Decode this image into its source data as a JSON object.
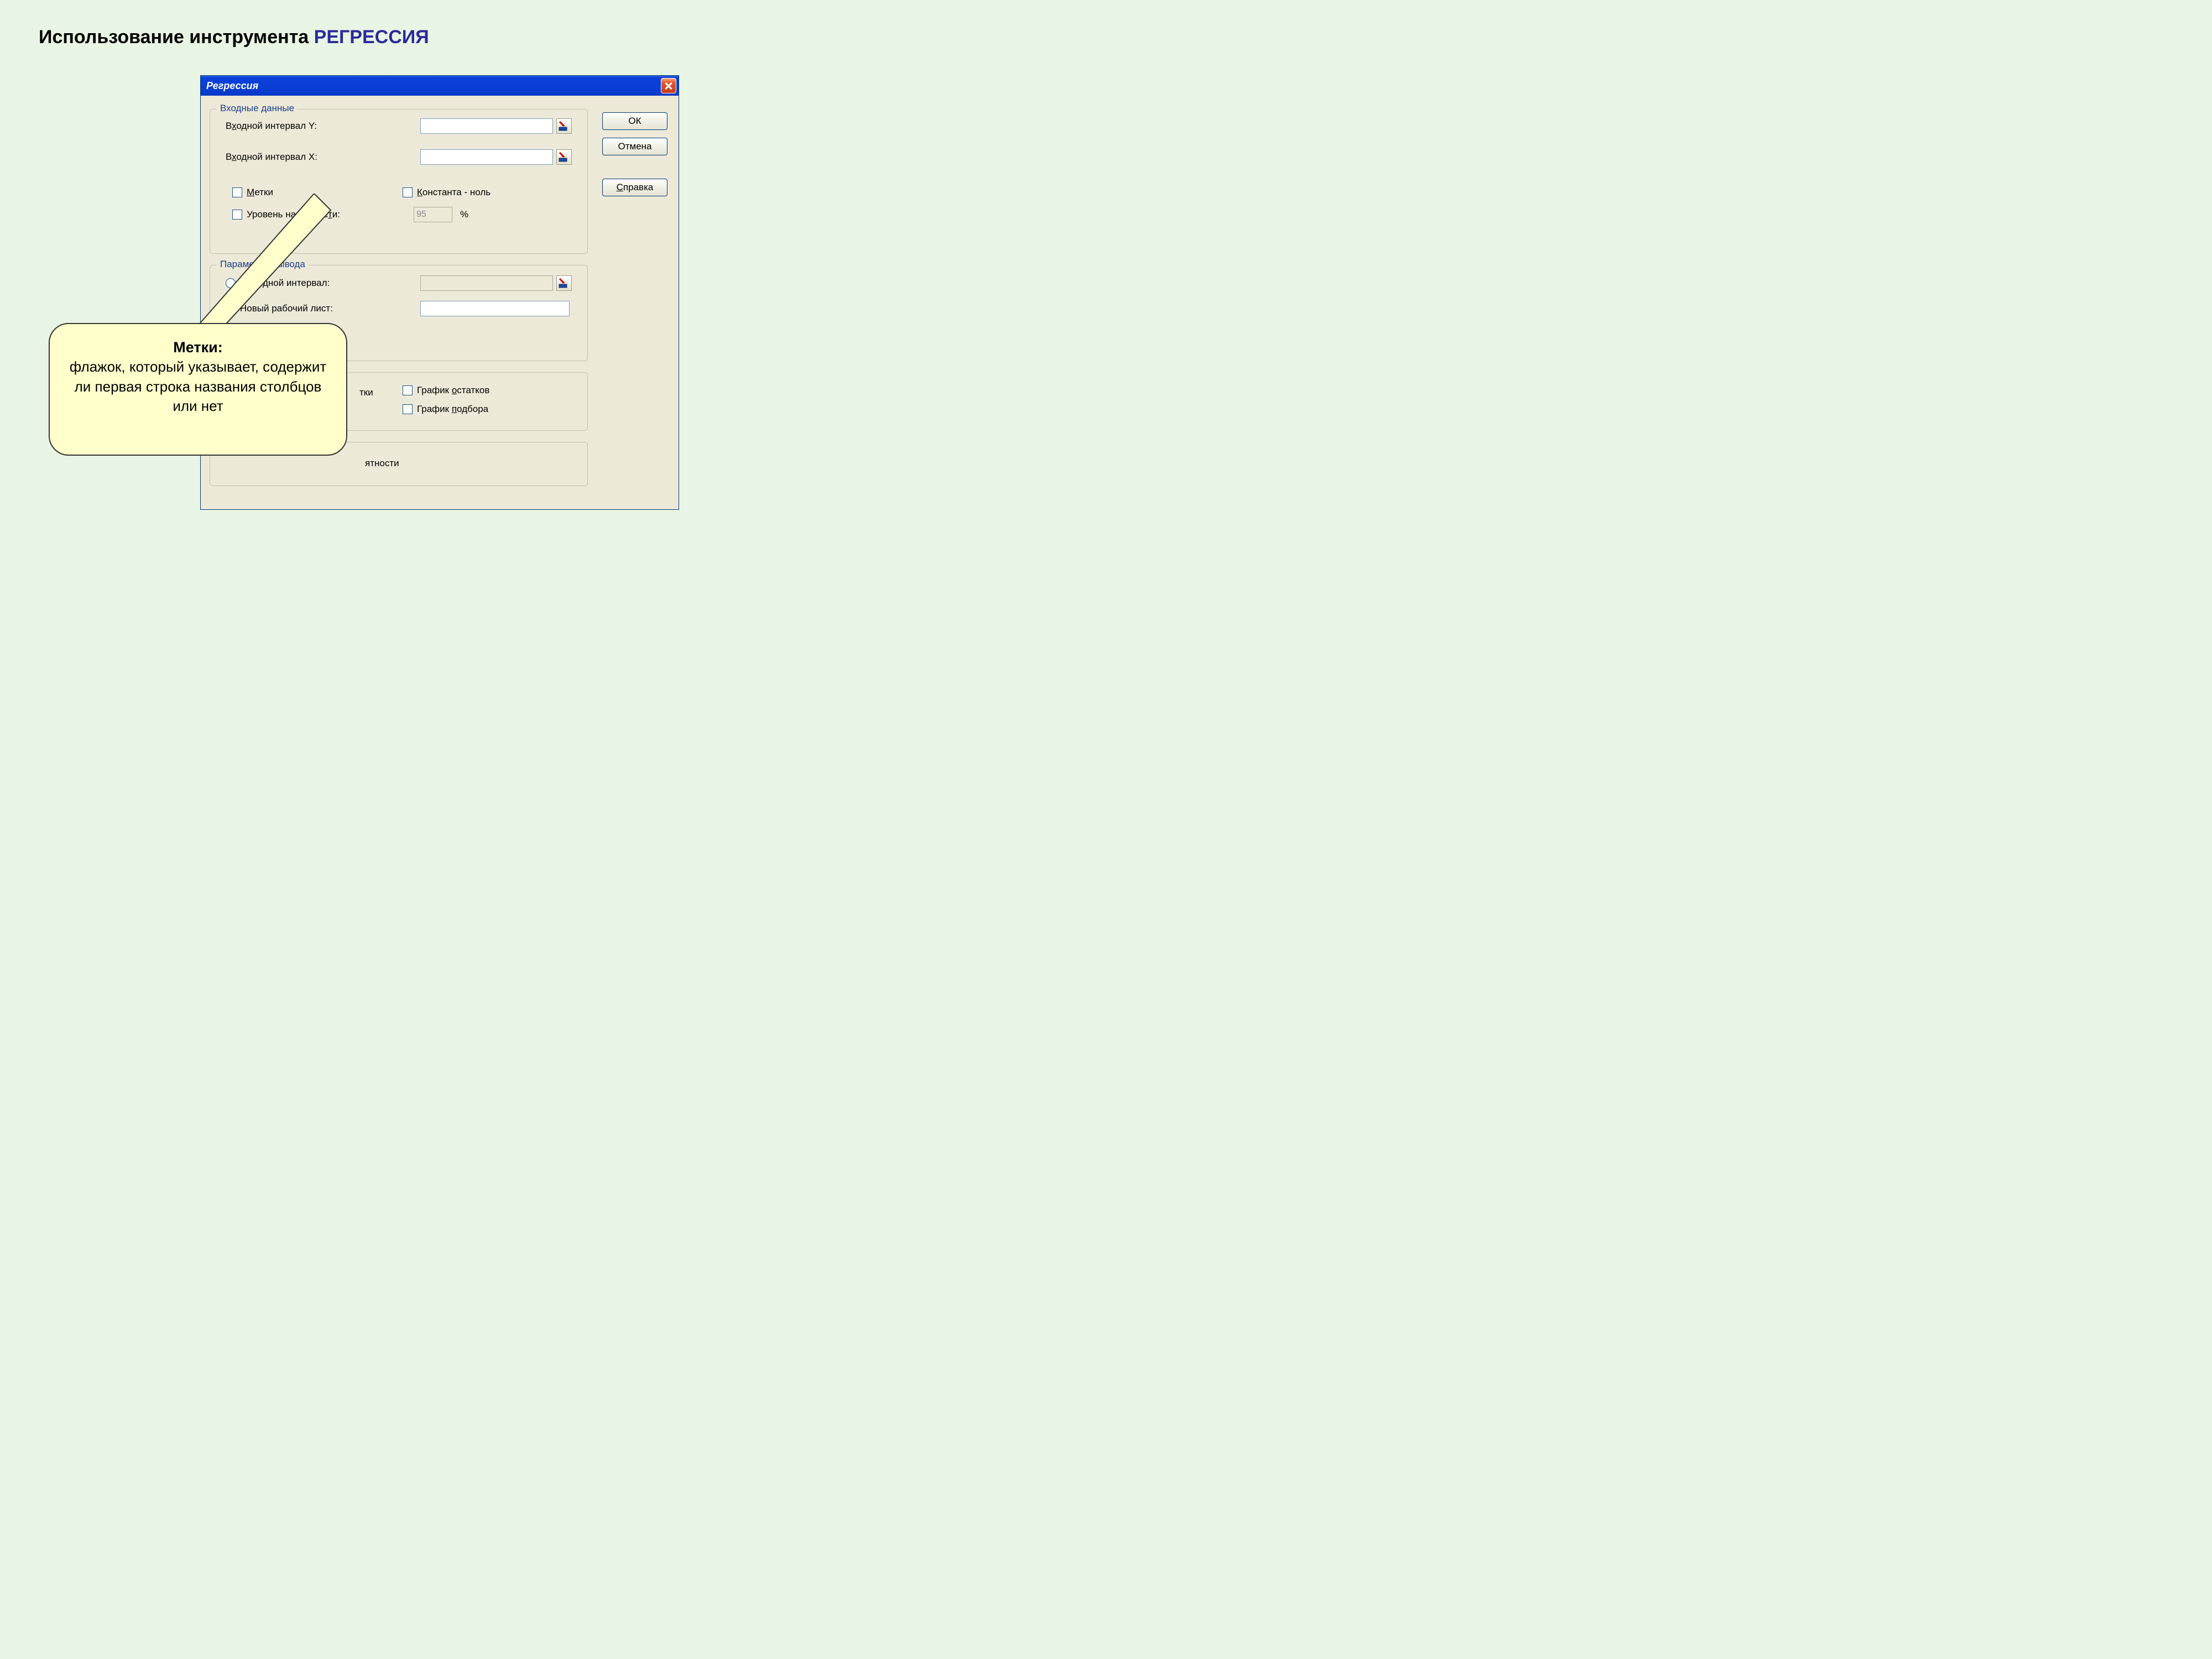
{
  "slide": {
    "title_plain": "Использование инструмента ",
    "title_accent": "РЕГРЕССИЯ"
  },
  "dialog": {
    "title": "Регрессия",
    "buttons": {
      "ok": "ОК",
      "cancel": "Отмена",
      "help": "Справка"
    },
    "group_input": {
      "legend": "Входные данные",
      "y_label_pre": "В",
      "y_label_u": "х",
      "y_label_post": "одной интервал Y:",
      "x_label_pre": "В",
      "x_label_u": "х",
      "x_label_post": "одной интервал X:",
      "labels_pre": "",
      "labels_u": "М",
      "labels_post": "етки",
      "const_pre": "",
      "const_u": "К",
      "const_post": "онстанта - ноль",
      "conf_pre": "Уровень надежнос",
      "conf_u": "т",
      "conf_post": "и:",
      "conf_value": "95",
      "conf_suffix": "%"
    },
    "group_output": {
      "legend": "Параметры вывода",
      "out_range_pre": "В",
      "out_range_u": "ы",
      "out_range_post": "ходной интервал:",
      "new_sheet": "Новый рабочий лист:"
    },
    "group_residuals": {
      "resid_chart_pre": "График ",
      "resid_chart_u": "о",
      "resid_chart_post": "статков",
      "fit_chart_pre": "График ",
      "fit_chart_u": "п",
      "fit_chart_post": "одбора",
      "resid_suffix": "тки"
    },
    "group_prob": {
      "suffix": "ятности"
    }
  },
  "callout": {
    "heading": "Метки:",
    "body": "флажок, который указывает, содержит ли первая строка названия столбцов или нет"
  }
}
